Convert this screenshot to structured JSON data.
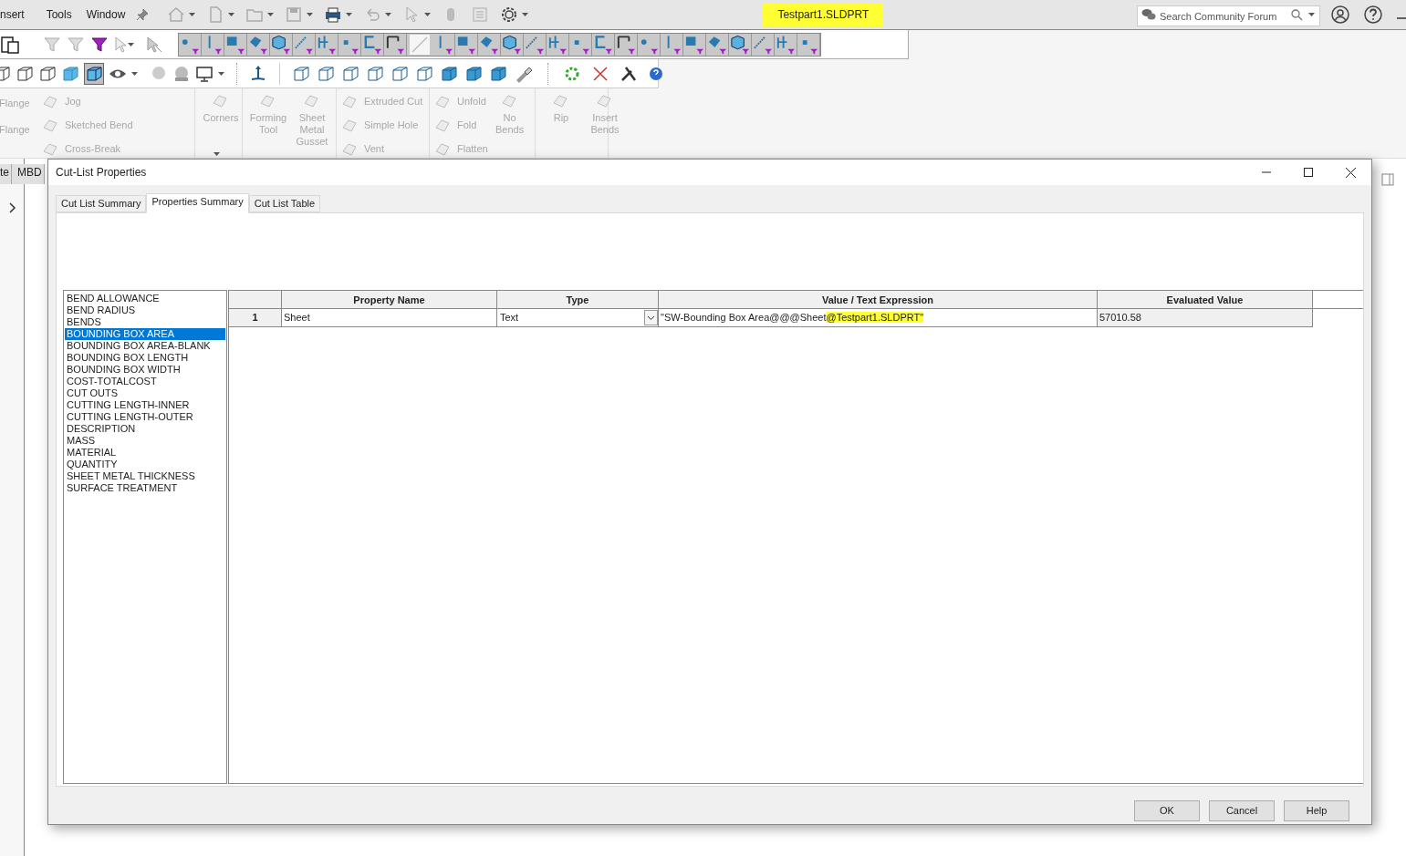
{
  "menu": [
    "nsert",
    "Tools",
    "Window"
  ],
  "document_title": {
    "text": "Testpart1.SLDPRT",
    "highlighted": true
  },
  "search": {
    "placeholder": "Search Community Forum"
  },
  "ribbon": [
    {
      "columns": [
        [
          {
            "label": "Flange",
            "kind": "small",
            "disabled": true
          },
          {
            "label": "Flange",
            "kind": "small",
            "disabled": true
          }
        ],
        [
          {
            "label": "Jog",
            "kind": "small",
            "disabled": true
          },
          {
            "label": "Sketched Bend",
            "kind": "small",
            "disabled": true
          },
          {
            "label": "Cross-Break",
            "kind": "small",
            "disabled": true
          }
        ]
      ]
    },
    {
      "columns": [
        [
          {
            "label": "Corners",
            "kind": "large",
            "disabled": true
          }
        ]
      ]
    },
    {
      "columns": [
        [
          {
            "label": "Forming Tool",
            "kind": "large",
            "disabled": true
          }
        ],
        [
          {
            "label": "Sheet Metal Gusset",
            "kind": "large",
            "disabled": true
          }
        ]
      ]
    },
    {
      "columns": [
        [
          {
            "label": "Extruded Cut",
            "kind": "small",
            "disabled": true
          },
          {
            "label": "Simple Hole",
            "kind": "small",
            "disabled": true
          },
          {
            "label": "Vent",
            "kind": "small",
            "disabled": true
          }
        ]
      ]
    },
    {
      "columns": [
        [
          {
            "label": "Unfold",
            "kind": "small",
            "disabled": true
          },
          {
            "label": "Fold",
            "kind": "small",
            "disabled": true
          },
          {
            "label": "Flatten",
            "kind": "small",
            "disabled": true
          }
        ],
        [
          {
            "label": "No Bends",
            "kind": "large",
            "disabled": true
          }
        ]
      ]
    },
    {
      "columns": [
        [
          {
            "label": "Rip",
            "kind": "large",
            "disabled": true
          }
        ],
        [
          {
            "label": "Insert Bends",
            "kind": "large",
            "disabled": true
          }
        ]
      ]
    }
  ],
  "side_tabs": [
    "te",
    "MBD"
  ],
  "dialog": {
    "title": "Cut-List Properties",
    "tabs": [
      {
        "label": "Cut List Summary",
        "selected": false
      },
      {
        "label": "Properties Summary",
        "selected": true
      },
      {
        "label": "Cut List Table",
        "selected": false
      }
    ],
    "property_list": [
      {
        "label": "BEND ALLOWANCE",
        "selected": false
      },
      {
        "label": "BEND RADIUS",
        "selected": false
      },
      {
        "label": "BENDS",
        "selected": false
      },
      {
        "label": "BOUNDING BOX AREA",
        "selected": true
      },
      {
        "label": "BOUNDING BOX AREA-BLANK",
        "selected": false
      },
      {
        "label": "BOUNDING BOX LENGTH",
        "selected": false
      },
      {
        "label": "BOUNDING BOX WIDTH",
        "selected": false
      },
      {
        "label": "COST-TOTALCOST",
        "selected": false
      },
      {
        "label": "CUT OUTS",
        "selected": false
      },
      {
        "label": "CUTTING LENGTH-INNER",
        "selected": false
      },
      {
        "label": "CUTTING LENGTH-OUTER",
        "selected": false
      },
      {
        "label": "DESCRIPTION",
        "selected": false
      },
      {
        "label": "MASS",
        "selected": false
      },
      {
        "label": "MATERIAL",
        "selected": false
      },
      {
        "label": "QUANTITY",
        "selected": false
      },
      {
        "label": "SHEET METAL THICKNESS",
        "selected": false
      },
      {
        "label": "SURFACE TREATMENT",
        "selected": false
      }
    ],
    "table": {
      "columns": [
        "Property Name",
        "Type",
        "Value / Text Expression",
        "Evaluated Value"
      ],
      "rows": [
        {
          "number": "1",
          "property_name": "Sheet",
          "type": "Text",
          "value": [
            {
              "text": "\"SW-Bounding Box Area@@@Sheet",
              "highlighted": false
            },
            {
              "text": "@Testpart1.SLDPRT\"",
              "highlighted": true
            }
          ],
          "evaluated_value": "57010.58"
        }
      ]
    },
    "buttons": [
      "OK",
      "Cancel",
      "Help"
    ]
  }
}
